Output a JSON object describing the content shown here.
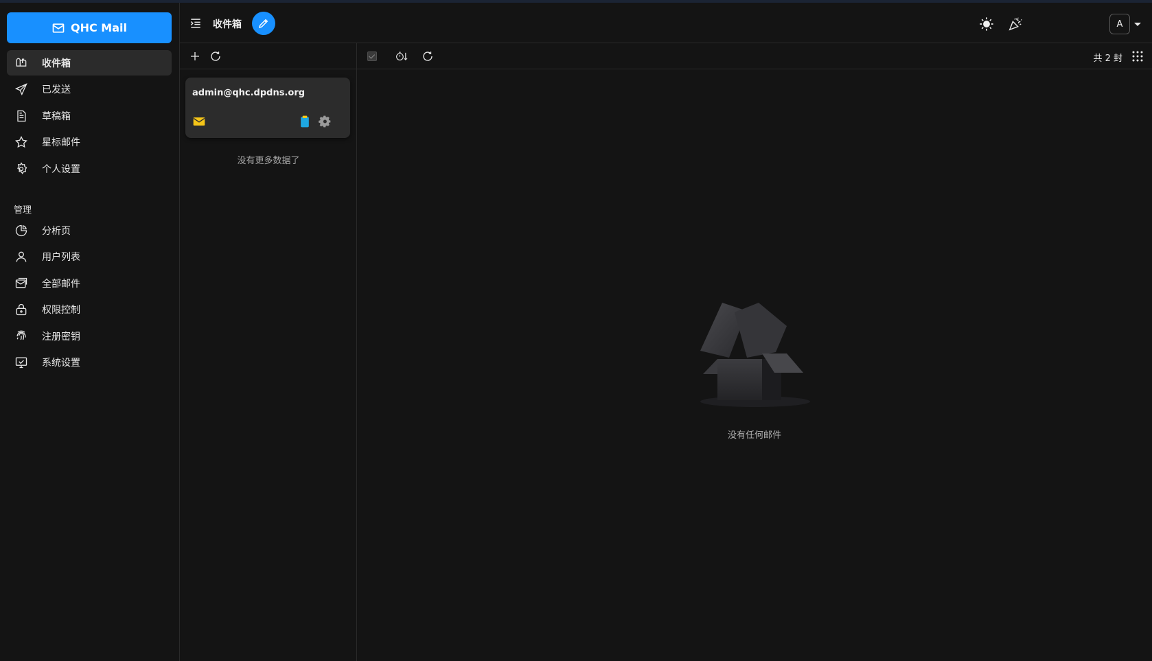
{
  "brand": {
    "name": "QHC Mail",
    "icon": "mail-icon",
    "color": "#1890ff"
  },
  "sidebar": {
    "items": [
      {
        "label": "收件箱",
        "icon": "inbox-icon",
        "active": true
      },
      {
        "label": "已发送",
        "icon": "send-icon"
      },
      {
        "label": "草稿箱",
        "icon": "draft-icon"
      },
      {
        "label": "星标邮件",
        "icon": "star-icon"
      },
      {
        "label": "个人设置",
        "icon": "gear-icon"
      }
    ],
    "section_label": "管理",
    "admin_items": [
      {
        "label": "分析页",
        "icon": "pie-chart-icon"
      },
      {
        "label": "用户列表",
        "icon": "user-icon"
      },
      {
        "label": "全部邮件",
        "icon": "all-mail-icon"
      },
      {
        "label": "权限控制",
        "icon": "lock-icon"
      },
      {
        "label": "注册密钥",
        "icon": "fingerprint-icon"
      },
      {
        "label": "系统设置",
        "icon": "monitor-check-icon"
      }
    ]
  },
  "header": {
    "title": "收件箱",
    "compose_icon": "pencil-icon",
    "theme_icon": "sun-icon",
    "effects_icon": "party-popper-icon",
    "avatar_letter": "A"
  },
  "accounts": {
    "items": [
      {
        "email": "admin@qhc.dpdns.org"
      }
    ],
    "no_more_text": "没有更多数据了"
  },
  "mails": {
    "count_text": "共 2 封",
    "empty_text": "没有任何邮件"
  }
}
